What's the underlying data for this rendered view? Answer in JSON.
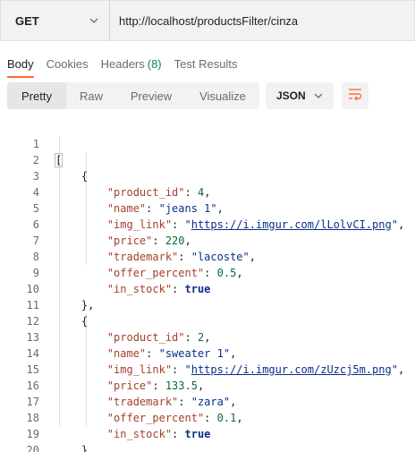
{
  "request": {
    "method": "GET",
    "url": "http://localhost/productsFilter/cinza"
  },
  "response_tabs": [
    {
      "label": "Body"
    },
    {
      "label": "Cookies"
    },
    {
      "label": "Headers",
      "count": "(8)"
    },
    {
      "label": "Test Results"
    }
  ],
  "format_toolbar": {
    "pretty": "Pretty",
    "raw": "Raw",
    "preview": "Preview",
    "visualize": "Visualize",
    "language": "JSON"
  },
  "code": {
    "line_numbers": [
      "1",
      "2",
      "3",
      "4",
      "5",
      "6",
      "7",
      "8",
      "9",
      "10",
      "11",
      "12",
      "13",
      "14",
      "15",
      "16",
      "17",
      "18",
      "19",
      "20"
    ],
    "open_bracket": "[",
    "close_bracket": "]",
    "open_brace": "{",
    "close_brace_comma": "},",
    "close_brace": "}",
    "products": [
      {
        "product_id_key": "\"product_id\"",
        "product_id": "4",
        "name_key": "\"name\"",
        "name": "\"jeans 1\"",
        "img_link_key": "\"img_link\"",
        "img_link": "https://i.imgur.com/lLolvCI.png",
        "price_key": "\"price\"",
        "price": "220",
        "trademark_key": "\"trademark\"",
        "trademark": "\"lacoste\"",
        "offer_percent_key": "\"offer_percent\"",
        "offer_percent": "0.5",
        "in_stock_key": "\"in_stock\"",
        "in_stock": "true"
      },
      {
        "product_id_key": "\"product_id\"",
        "product_id": "2",
        "name_key": "\"name\"",
        "name": "\"sweater 1\"",
        "img_link_key": "\"img_link\"",
        "img_link": "https://i.imgur.com/zUzcj5m.png",
        "price_key": "\"price\"",
        "price": "133.5",
        "trademark_key": "\"trademark\"",
        "trademark": "\"zara\"",
        "offer_percent_key": "\"offer_percent\"",
        "offer_percent": "0.1",
        "in_stock_key": "\"in_stock\"",
        "in_stock": "true"
      }
    ]
  },
  "colors": {
    "accent": "#ff6c37",
    "count_green": "#0f8a4a"
  },
  "icons": {
    "method_dropdown": "chevron-down-icon",
    "json_dropdown": "chevron-down-icon",
    "wrap": "wrap-lines-icon"
  }
}
